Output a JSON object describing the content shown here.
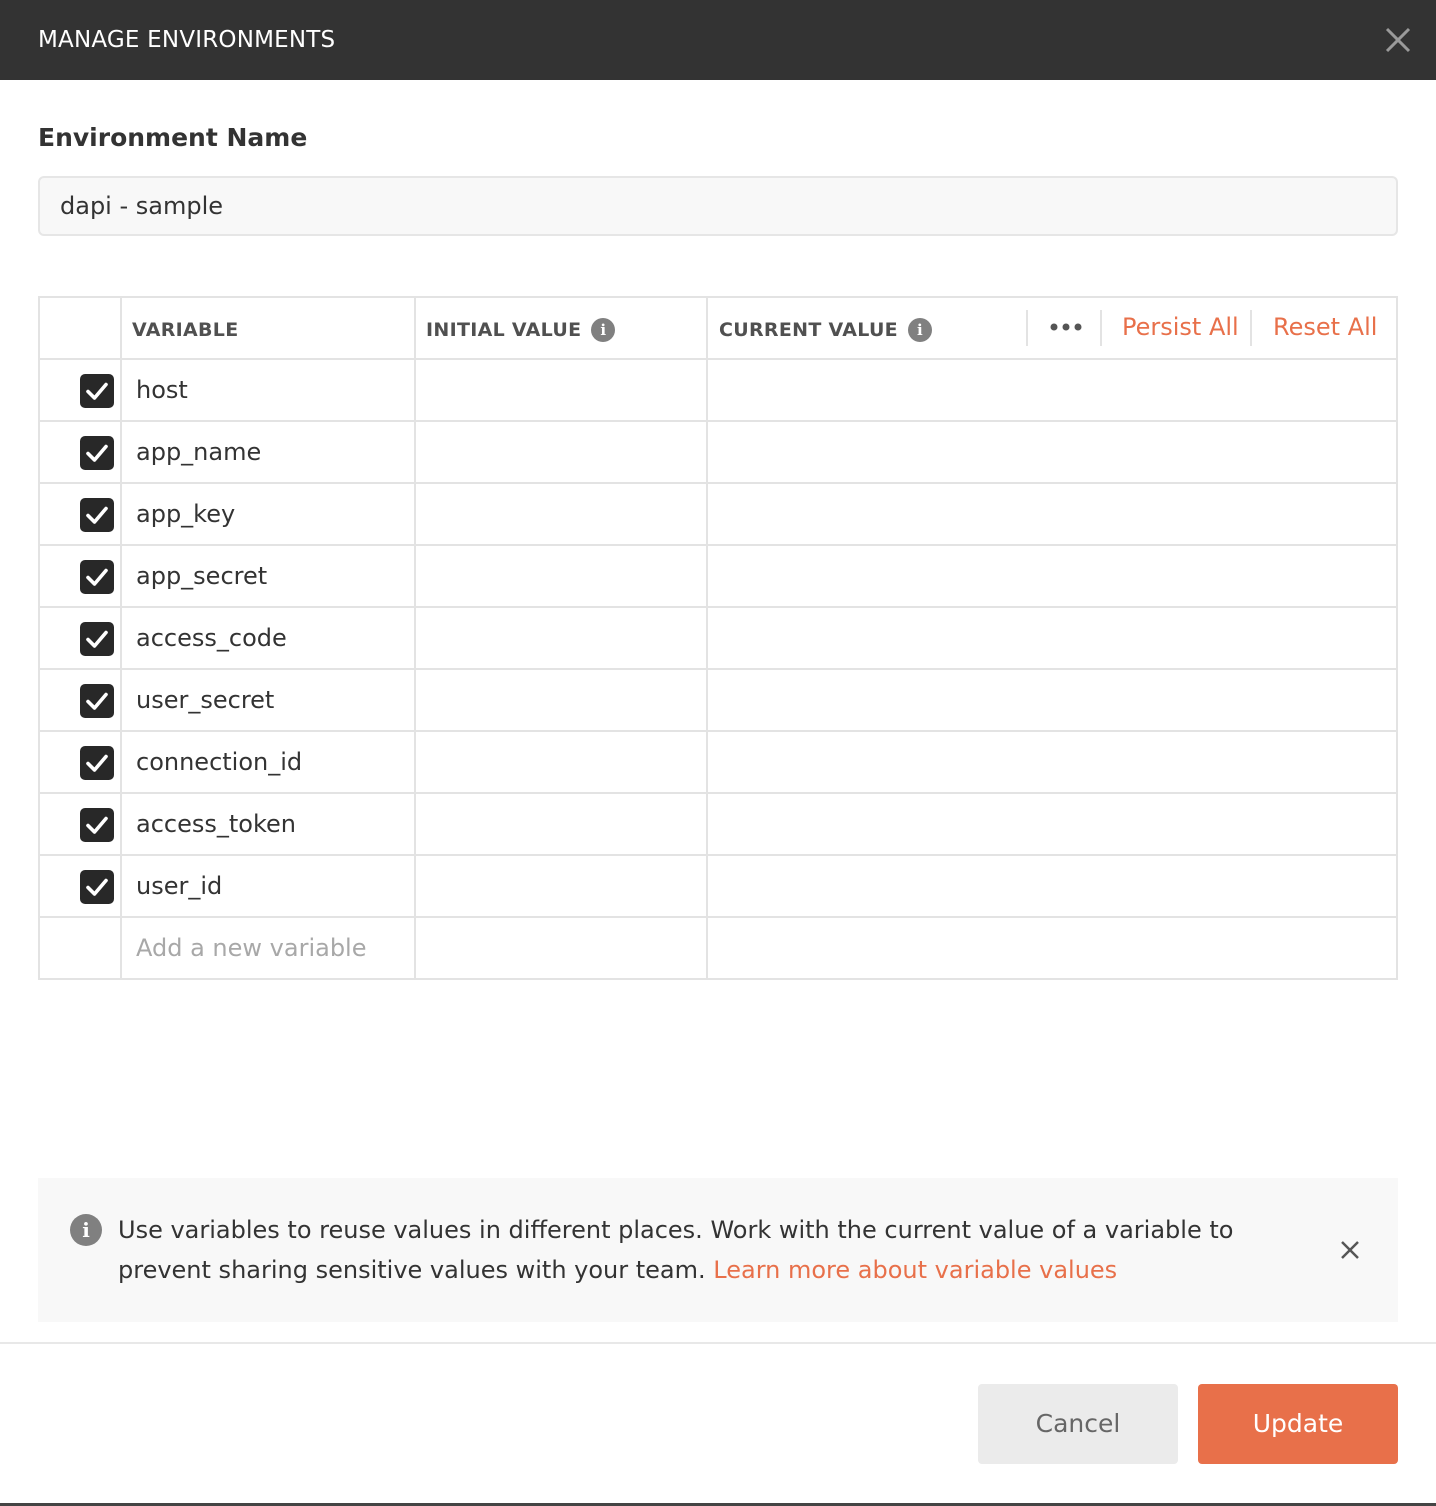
{
  "modal": {
    "title": "MANAGE ENVIRONMENTS",
    "close_icon": "close-icon"
  },
  "environment": {
    "label": "Environment Name",
    "name_value": "dapi - sample"
  },
  "table": {
    "headers": {
      "variable": "VARIABLE",
      "initial_value": "INITIAL VALUE",
      "current_value": "CURRENT VALUE",
      "more_icon": "ellipsis-icon",
      "persist_all": "Persist All",
      "reset_all": "Reset All"
    },
    "rows": [
      {
        "enabled": true,
        "variable": "host",
        "initial_value": "",
        "current_value": ""
      },
      {
        "enabled": true,
        "variable": "app_name",
        "initial_value": "",
        "current_value": ""
      },
      {
        "enabled": true,
        "variable": "app_key",
        "initial_value": "",
        "current_value": ""
      },
      {
        "enabled": true,
        "variable": "app_secret",
        "initial_value": "",
        "current_value": ""
      },
      {
        "enabled": true,
        "variable": "access_code",
        "initial_value": "",
        "current_value": ""
      },
      {
        "enabled": true,
        "variable": "user_secret",
        "initial_value": "",
        "current_value": ""
      },
      {
        "enabled": true,
        "variable": "connection_id",
        "initial_value": "",
        "current_value": ""
      },
      {
        "enabled": true,
        "variable": "access_token",
        "initial_value": "",
        "current_value": ""
      },
      {
        "enabled": true,
        "variable": "user_id",
        "initial_value": "",
        "current_value": ""
      }
    ],
    "new_variable_placeholder": "Add a new variable"
  },
  "banner": {
    "text": "Use variables to reuse values in different places. Work with the current value of a variable to prevent sharing sensitive values with your team.",
    "link": "Learn more about variable values",
    "icon": "info-icon",
    "close_icon": "close-icon"
  },
  "footer": {
    "cancel_label": "Cancel",
    "update_label": "Update"
  },
  "colors": {
    "accent": "#e8704a",
    "titlebar": "#333333",
    "checkbox": "#282828"
  }
}
